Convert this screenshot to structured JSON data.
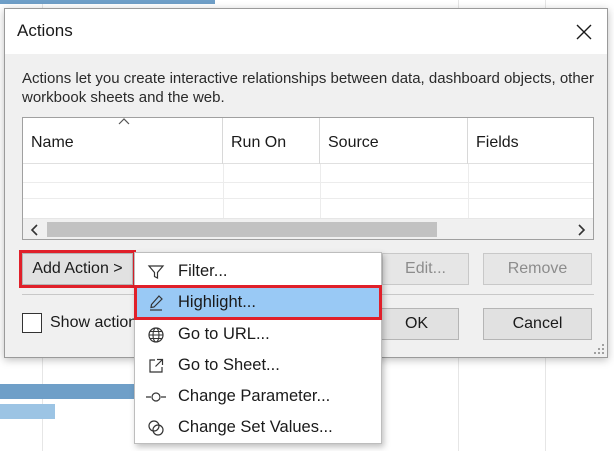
{
  "dialog": {
    "title": "Actions",
    "description": "Actions let you create interactive relationships between data, dashboard objects, other workbook sheets and the web."
  },
  "table": {
    "columns": [
      "Name",
      "Run On",
      "Source",
      "Fields"
    ]
  },
  "buttons": {
    "add_action": "Add Action >",
    "edit": "Edit...",
    "remove": "Remove",
    "ok": "OK",
    "cancel": "Cancel"
  },
  "checkbox": {
    "label": "Show action"
  },
  "menu": {
    "items": [
      {
        "label": "Filter...",
        "icon": "filter-icon"
      },
      {
        "label": "Highlight...",
        "icon": "highlight-pen-icon"
      },
      {
        "label": "Go to URL...",
        "icon": "globe-icon"
      },
      {
        "label": "Go to Sheet...",
        "icon": "external-sheet-icon"
      },
      {
        "label": "Change Parameter...",
        "icon": "parameter-icon"
      },
      {
        "label": "Change Set Values...",
        "icon": "set-values-icon"
      }
    ]
  },
  "colors": {
    "highlight_outline": "#e0202a",
    "menu_selection": "#99c9f5",
    "background_bar": "#6f9fc8"
  }
}
